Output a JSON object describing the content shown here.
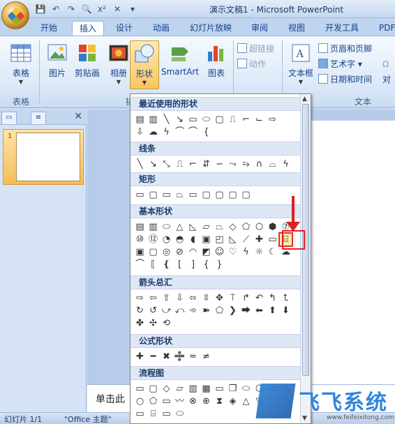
{
  "window": {
    "title": "演示文稿1 - Microsoft PowerPoint"
  },
  "tabs": [
    {
      "label": "开始",
      "active": false
    },
    {
      "label": "插入",
      "active": true
    },
    {
      "label": "设计",
      "active": false
    },
    {
      "label": "动画",
      "active": false
    },
    {
      "label": "幻灯片放映",
      "active": false
    },
    {
      "label": "审阅",
      "active": false
    },
    {
      "label": "视图",
      "active": false
    },
    {
      "label": "开发工具",
      "active": false
    },
    {
      "label": "PDF",
      "active": false
    }
  ],
  "ribbon": {
    "groups": {
      "table": "表格",
      "illustrations": "插",
      "text": "文本"
    },
    "buttons": {
      "table": "表格",
      "picture": "图片",
      "clipart": "剪贴画",
      "album": "相册",
      "shapes": "形状",
      "smartart": "SmartArt",
      "chart": "图表",
      "hyperlink": "超链接",
      "action": "动作",
      "textbox": "文本框",
      "header_footer": "页眉和页脚",
      "wordart": "艺术字",
      "datetime": "日期和时间",
      "symbol": "Ω",
      "object": "对"
    }
  },
  "gallery": {
    "sections": {
      "recent": "最近使用的形状",
      "lines": "线条",
      "rect": "矩形",
      "basic": "基本形状",
      "arrows": "箭头总汇",
      "equation": "公式形状",
      "flowchart": "流程图"
    },
    "highlighted_shape": "can-shape"
  },
  "notes": {
    "placeholder": "单击此"
  },
  "status": {
    "slide": "幻灯片 1/1",
    "theme": "\"Office 主题\""
  },
  "watermark": {
    "text": "飞飞系统",
    "url": "www.feifeixitong.com"
  },
  "colors": {
    "accent": "#15428b",
    "highlight": "#e02020",
    "ribbon_bg": "#dbe8f7"
  }
}
